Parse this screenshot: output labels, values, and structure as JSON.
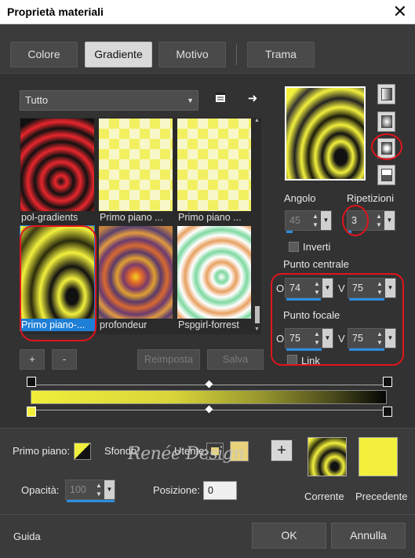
{
  "window": {
    "title": "Proprietà materiali",
    "close_glyph": "✕"
  },
  "tabs": [
    {
      "label": "Colore",
      "active": false
    },
    {
      "label": "Gradiente",
      "active": true
    },
    {
      "label": "Motivo",
      "active": false
    },
    {
      "label": "Trama",
      "active": false
    }
  ],
  "category_dropdown": {
    "value": "Tutto"
  },
  "gallery": {
    "items": [
      {
        "label": "pol-gradients",
        "selected": false
      },
      {
        "label": "Primo piano ...",
        "selected": false
      },
      {
        "label": "Primo piano ...",
        "selected": false
      },
      {
        "label": "Primo piano-...",
        "selected": true
      },
      {
        "label": "profondeur",
        "selected": false
      },
      {
        "label": "Pspgirl-forrest",
        "selected": false
      }
    ]
  },
  "buttons": {
    "add": "+",
    "remove": "-",
    "reset": "Reimposta",
    "save": "Salva",
    "ok": "OK",
    "cancel": "Annulla",
    "help": "Guida"
  },
  "gradient_settings": {
    "angle_label": "Angolo",
    "angle_value": "45",
    "repeats_label": "Ripetizioni",
    "repeats_value": "3",
    "invert_label": "Inverti",
    "center_label": "Punto centrale",
    "center_h_prefix": "O",
    "center_h": "74",
    "center_v_prefix": "V",
    "center_v": "75",
    "focal_label": "Punto focale",
    "focal_h_prefix": "O",
    "focal_h": "75",
    "focal_v_prefix": "V",
    "focal_v": "75",
    "link_label": "Link"
  },
  "bottom": {
    "foreground_label": "Primo piano:",
    "background_label": "Sfondo:",
    "user_label": "Utente:",
    "opacity_label": "Opacità:",
    "opacity_value": "100",
    "position_label": "Posizione:",
    "position_value": "0",
    "current_label": "Corrente",
    "previous_label": "Precedente"
  },
  "watermark": "Renée Design",
  "colors": {
    "accent": "#1e7fd6",
    "yellow": "#f2f03c",
    "user_swatch": "#e8d27a",
    "highlight": "#e0141c"
  }
}
